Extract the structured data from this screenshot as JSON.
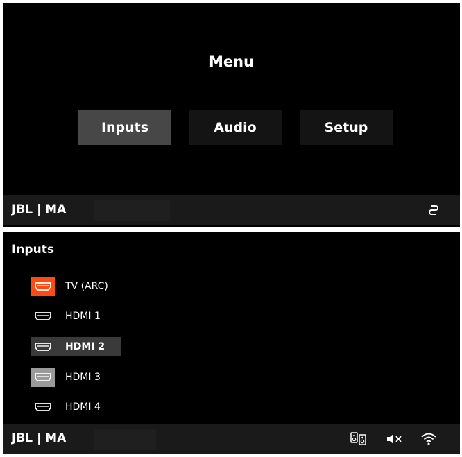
{
  "menu": {
    "title": "Menu",
    "buttons": [
      {
        "label": "Inputs",
        "selected": true
      },
      {
        "label": "Audio",
        "selected": false
      },
      {
        "label": "Setup",
        "selected": false
      }
    ],
    "status_bar": {
      "brand": "JBL | MA",
      "icons": [
        "link-icon"
      ]
    }
  },
  "inputs": {
    "title": "Inputs",
    "items": [
      {
        "label": "TV (ARC)",
        "icon": "hdmi-icon",
        "state": "active-source"
      },
      {
        "label": "HDMI 1",
        "icon": "hdmi-icon",
        "state": "normal"
      },
      {
        "label": "HDMI 2",
        "icon": "hdmi-icon",
        "state": "focused"
      },
      {
        "label": "HDMI 3",
        "icon": "hdmi-icon",
        "state": "highlighted"
      },
      {
        "label": "HDMI 4",
        "icon": "hdmi-icon",
        "state": "normal"
      }
    ],
    "status_bar": {
      "brand": "JBL | MA",
      "icons": [
        "speakers-icon",
        "mute-icon",
        "wifi-icon"
      ]
    }
  },
  "colors": {
    "background": "#000000",
    "status_bar": "#1a1a1a",
    "selected_button": "#474747",
    "source_accent": "#ff4a14"
  }
}
